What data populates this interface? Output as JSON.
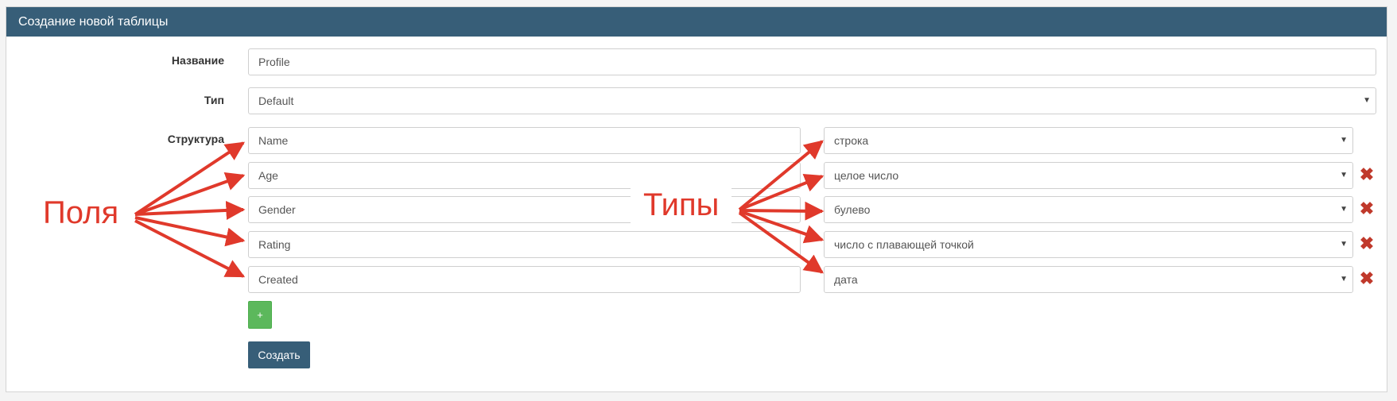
{
  "panel": {
    "title": "Создание новой таблицы"
  },
  "form": {
    "name_label": "Название",
    "name_value": "Profile",
    "type_label": "Тип",
    "type_value": "Default",
    "structure_label": "Структура",
    "fields": [
      {
        "name": "Name",
        "type": "строка",
        "removable": false
      },
      {
        "name": "Age",
        "type": "целое число",
        "removable": true
      },
      {
        "name": "Gender",
        "type": "булево",
        "removable": true
      },
      {
        "name": "Rating",
        "type": "число с плавающей точкой",
        "removable": true
      },
      {
        "name": "Created",
        "type": "дата",
        "removable": true
      }
    ],
    "add_label": "+",
    "create_label": "Создать"
  },
  "annotations": {
    "fields": "Поля",
    "types": "Типы"
  },
  "colors": {
    "header": "#375e78",
    "add": "#5cb85c",
    "arrow": "#e0392b",
    "remove": "#c0392b"
  },
  "icons": {
    "remove": "close-icon",
    "caret": "chevron-down-icon"
  }
}
